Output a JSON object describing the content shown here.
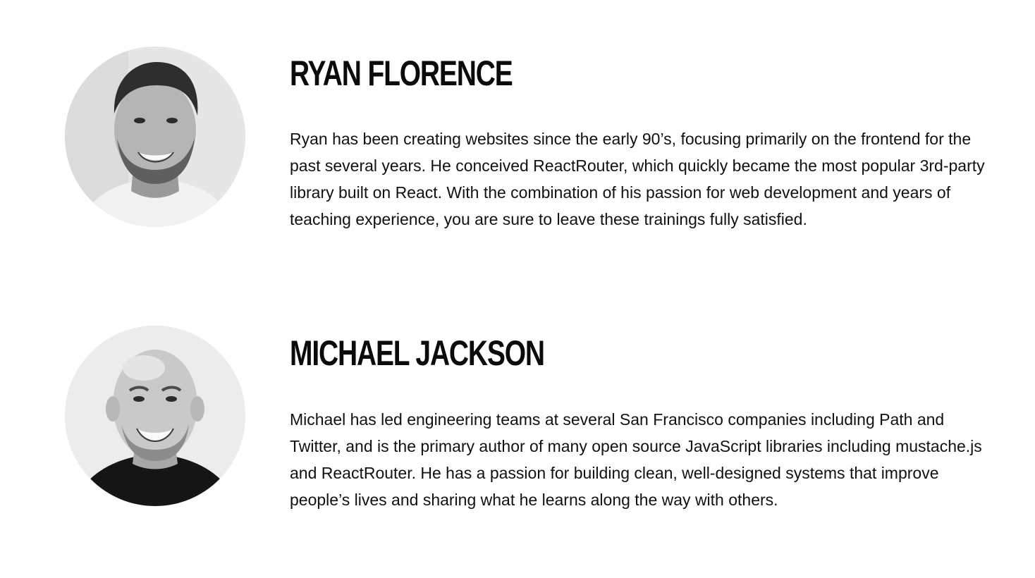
{
  "instructors": [
    {
      "name": "RYAN FLORENCE",
      "photo_alt": "Ryan Florence",
      "bio": "Ryan has been creating websites since the early 90’s, focusing primarily on the frontend for the past several years. He conceived ReactRouter, which quickly became the most popular 3rd-party library built on React. With the combination of his passion for web development and years of teaching experience, you are sure to leave these trainings fully satisfied."
    },
    {
      "name": "MICHAEL JACKSON",
      "photo_alt": "Michael Jackson",
      "bio": "Michael has led engineering teams at several San Francisco companies including Path and Twitter, and is the primary author of many open source JavaScript libraries including mustache.js and ReactRouter. He has a passion for building clean, well-designed systems that improve people’s lives and sharing what he learns along the way with others."
    }
  ]
}
